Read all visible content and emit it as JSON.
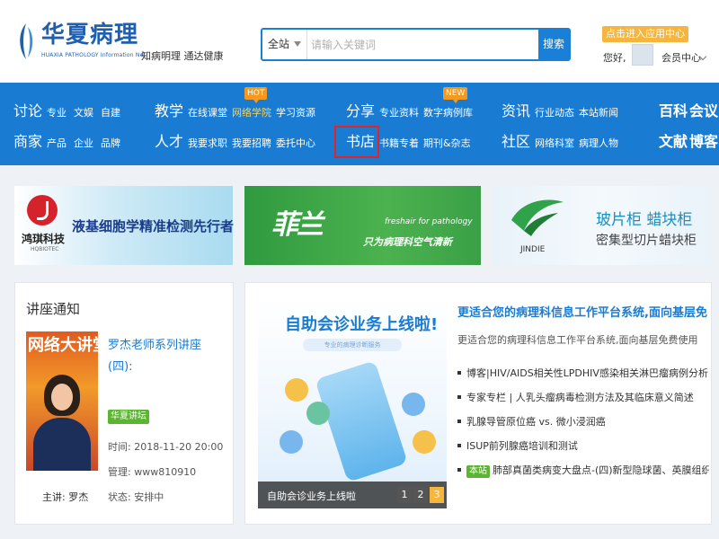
{
  "header": {
    "logo_cn": "华夏病理",
    "logo_en": "HUAXIA PATHOLOGY Information Net",
    "slogan": "知病明理 通达健康",
    "search": {
      "scope": "全站",
      "placeholder": "请输入关键词",
      "button": "搜索"
    },
    "app_center": "点击进入应用中心",
    "greeting": "您好,",
    "member_center": "会员中心"
  },
  "nav": {
    "g1": {
      "head1": "讨论",
      "row1": [
        "专业",
        "文娱",
        "自建"
      ],
      "head2": "商家",
      "row2": [
        "产品",
        "企业",
        "品牌"
      ]
    },
    "g2": {
      "head1": "教学",
      "row1": [
        "在线课堂",
        "网络学院",
        "学习资源"
      ],
      "hot": "HOT",
      "head2": "人才",
      "row2": [
        "我要求职",
        "我要招聘",
        "委托中心"
      ]
    },
    "g3": {
      "head1": "分享",
      "row1": [
        "专业资料",
        "数字病例库"
      ],
      "new": "NEW",
      "head2": "书店",
      "row2": [
        "书籍专着",
        "期刊&杂志"
      ]
    },
    "g4": {
      "head1": "资讯",
      "row1": [
        "行业动态",
        "本站新闻"
      ],
      "head2": "社区",
      "row2": [
        "网络科室",
        "病理人物"
      ]
    },
    "g5": {
      "r1": [
        "百科",
        "会议"
      ],
      "r2": [
        "文献",
        "博客"
      ]
    }
  },
  "banners": {
    "b1": {
      "name": "鸿琪科技",
      "en": "HQBIOTEC",
      "slogan": "液基细胞学精准检测先行者"
    },
    "b2": {
      "mark": "菲兰",
      "en": "freshair for pathology",
      "cn": "只为病理科空气清新"
    },
    "b3": {
      "en": "JINDIE",
      "t1": "玻片柜  蜡块柜",
      "t2": "密集型切片蜡块柜"
    }
  },
  "lecture": {
    "title": "讲座通知",
    "image_text": "网络大讲堂",
    "name": "罗杰老师系列讲座 (四):",
    "tag": "华夏讲坛",
    "time": "时间: 2018-11-20 20:00",
    "admin": "管理: www810910",
    "host": "主讲: 罗杰",
    "status": "状态: 安排中"
  },
  "feature": {
    "slide_title": "自助会诊业务上线啦!",
    "slide_sub": "专业的病理诊断服务",
    "caption": "自助会诊业务上线啦",
    "pages": [
      "1",
      "2",
      "3"
    ],
    "head": "更适合您的病理科信息工作平台系统,面向基层免",
    "sub": "更适合您的病理科信息工作平台系统,面向基层免费使用",
    "items": [
      "博客|HIV/AIDS相关性LPDHIV感染相关淋巴瘤病例分析",
      "专家专栏 | 人乳头瘤病毒检测方法及其临床意义简述",
      "乳腺导管原位癌 vs. 微小浸润癌",
      "ISUP前列腺癌培训和测试",
      "肺部真菌类病变大盘点-(四)新型隐球菌、英膜组织胞"
    ],
    "item_tag": "本站"
  },
  "colors": {
    "brand": "#1a7bd2",
    "accent": "#f5b53f",
    "highlight": "#ffd34d",
    "tag_green": "#5cb531"
  }
}
